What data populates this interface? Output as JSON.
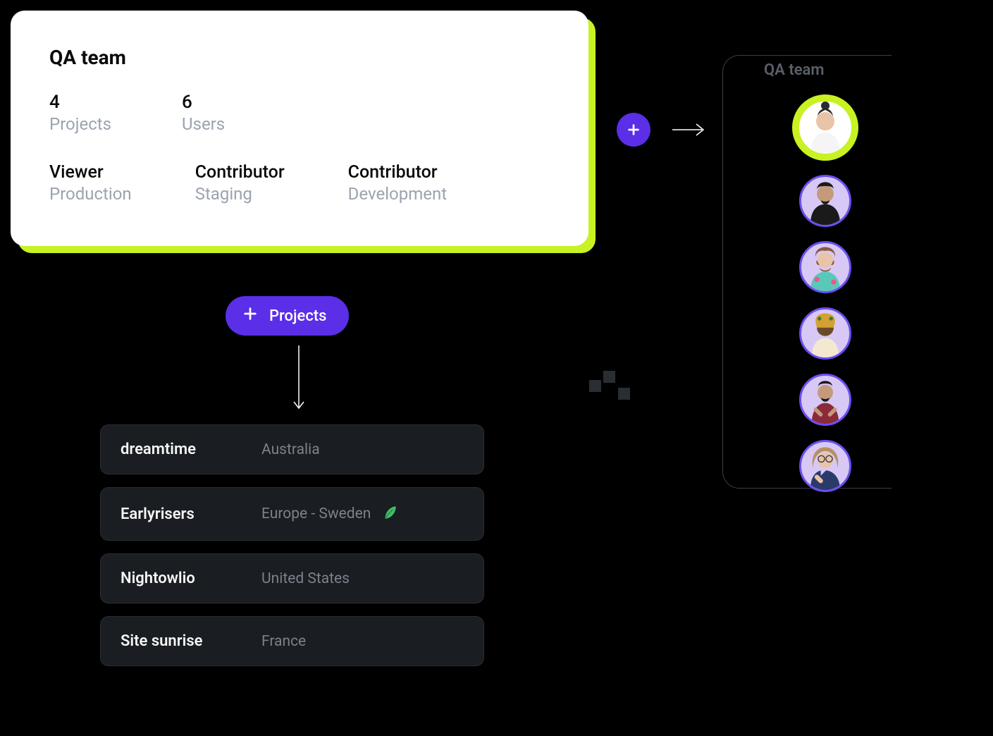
{
  "team": {
    "title": "QA team",
    "stats": [
      {
        "value": "4",
        "label": "Projects"
      },
      {
        "value": "6",
        "label": "Users"
      }
    ],
    "roles": [
      {
        "name": "Viewer",
        "env": "Production"
      },
      {
        "name": "Contributor",
        "env": "Staging"
      },
      {
        "name": "Contributor",
        "env": "Development"
      }
    ]
  },
  "projects_button": {
    "label": "Projects"
  },
  "projects": [
    {
      "name": "dreamtime",
      "region": "Australia",
      "green": false
    },
    {
      "name": "Earlyrisers",
      "region": "Europe - Sweden",
      "green": true
    },
    {
      "name": "Nightowlio",
      "region": "United States",
      "green": false
    },
    {
      "name": "Site sunrise",
      "region": "France",
      "green": false
    }
  ],
  "team_panel": {
    "title": "QA team",
    "avatars": [
      {
        "highlighted": true
      },
      {
        "highlighted": false
      },
      {
        "highlighted": false
      },
      {
        "highlighted": false
      },
      {
        "highlighted": false
      },
      {
        "highlighted": false
      }
    ]
  },
  "colors": {
    "accent_green": "#c8f221",
    "accent_purple": "#5b2ee8"
  }
}
